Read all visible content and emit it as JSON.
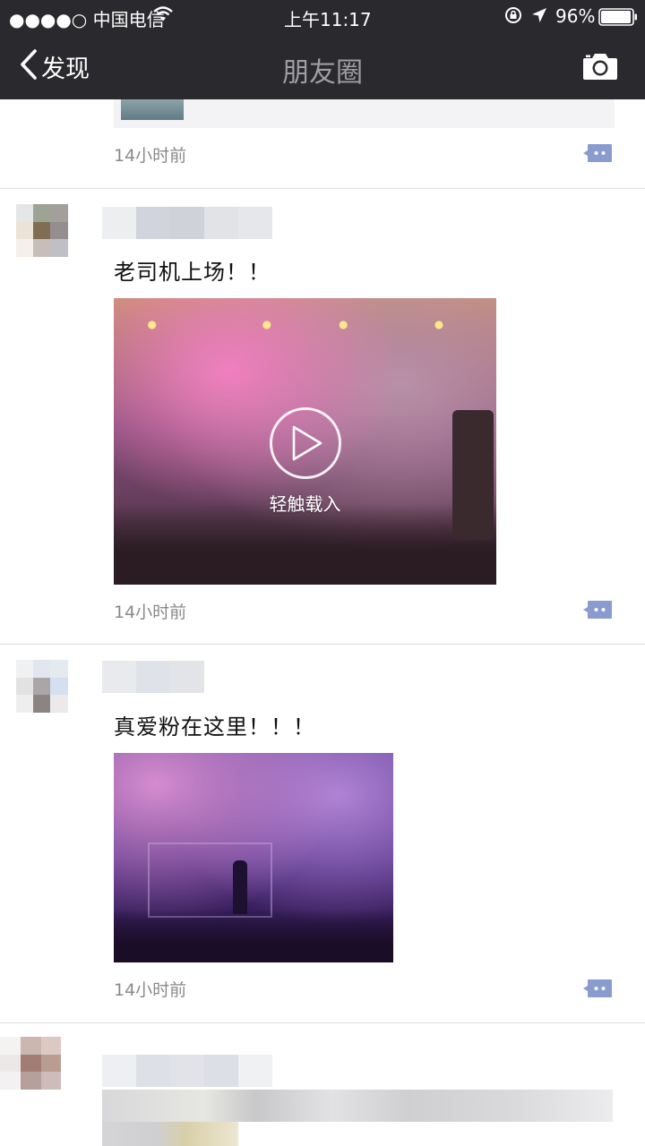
{
  "status_bar": {
    "carrier": "●●●●○ 中国电信",
    "time": "上午11:17",
    "battery": "96%"
  },
  "nav": {
    "back_label": "发现",
    "title": "朋友圈"
  },
  "posts": [
    {
      "timestamp": "14小时前"
    },
    {
      "text": "老司机上场！！",
      "video_label": "轻触载入",
      "timestamp": "14小时前"
    },
    {
      "text": "真爱粉在这里！！！",
      "timestamp": "14小时前"
    }
  ],
  "colors": {
    "bar_background": "#2a2a2e",
    "title_gray": "#9e9ea4",
    "comment_icon": "#8a9ccf"
  }
}
